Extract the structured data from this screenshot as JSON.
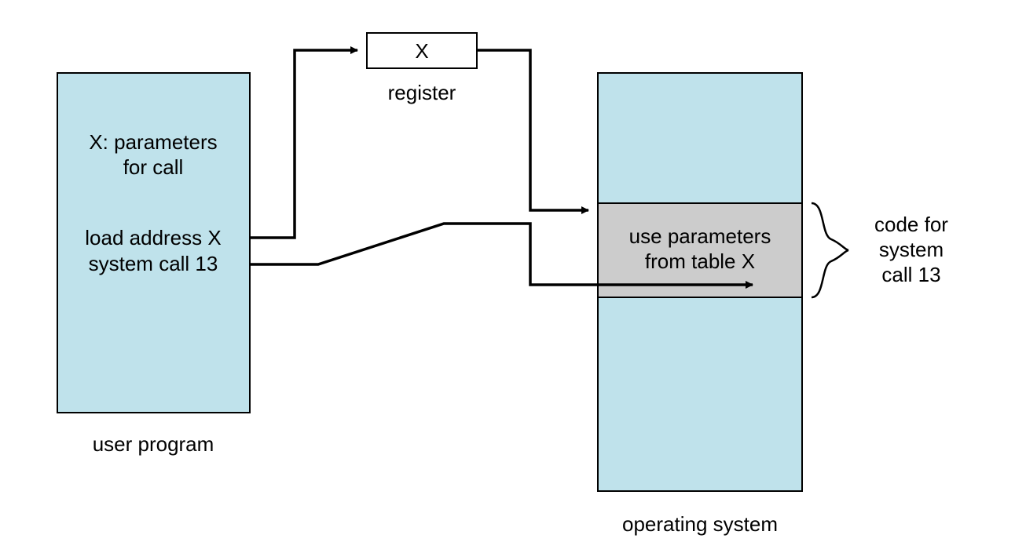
{
  "diagram": {
    "user_program": {
      "label": "user program",
      "line1": "X: parameters",
      "line2": "for call",
      "line3": "load address X",
      "line4": "system call 13"
    },
    "register": {
      "label": "register",
      "value": "X"
    },
    "operating_system": {
      "label": "operating system",
      "segment_line1": "use parameters",
      "segment_line2": "from table X"
    },
    "annotation": {
      "line1": "code for",
      "line2": "system",
      "line3": "call 13"
    }
  },
  "colors": {
    "box_fill": "#bfe2eb",
    "segment_fill": "#cccccc",
    "stroke": "#000000"
  }
}
